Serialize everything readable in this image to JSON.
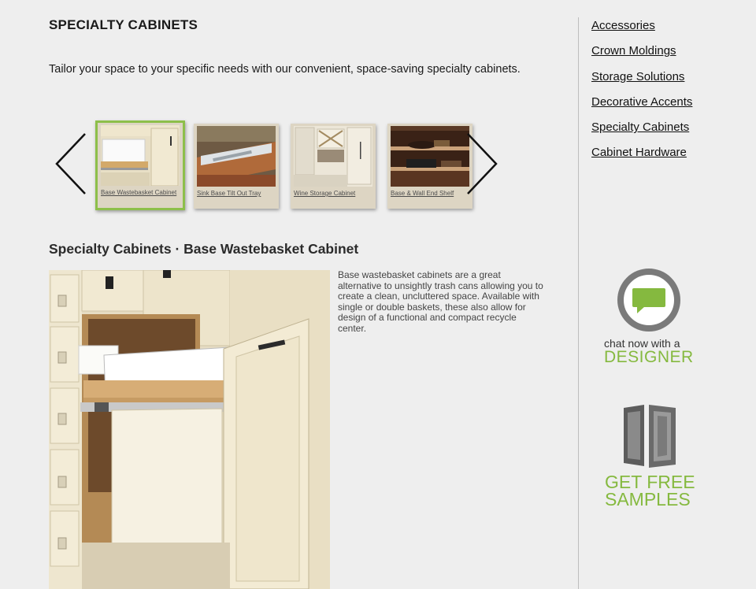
{
  "page": {
    "title": "SPECIALTY CABINETS",
    "intro": "Tailor your space to your specific needs with our convenient, space-saving specialty cabinets."
  },
  "carousel": {
    "items": [
      {
        "label": "Base Wastebasket Cabinet",
        "selected": true
      },
      {
        "label": "Sink Base Tilt Out Tray",
        "selected": false
      },
      {
        "label": "Wine Storage Cabinet",
        "selected": false
      },
      {
        "label": "Base & Wall End Shelf",
        "selected": false
      }
    ],
    "accent_color": "#8dbf4a"
  },
  "detail": {
    "heading": "Specialty Cabinets · Base Wastebasket Cabinet",
    "description": "Base wastebasket cabinets are a great alternative to unsightly trash cans allowing you to create a clean, uncluttered space. Available with single or double baskets, these also allow for design of a functional and compact recycle center."
  },
  "sidebar": {
    "links": [
      "Accessories",
      "Crown Moldings",
      "Storage Solutions",
      "Decorative Accents",
      "Specialty Cabinets",
      "Cabinet Hardware"
    ],
    "chat": {
      "line1": "chat now with a",
      "line2": "DESIGNER",
      "icon": "speech-bubble-icon"
    },
    "samples": {
      "line1": "GET FREE",
      "line2": "SAMPLES",
      "icon": "cabinet-door-icon"
    },
    "brand_green": "#85b93f"
  }
}
